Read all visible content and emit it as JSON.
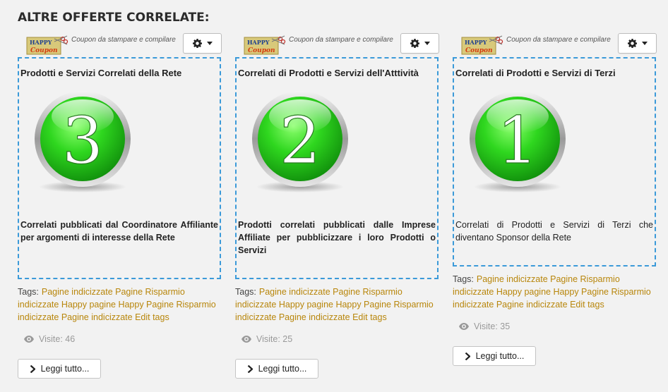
{
  "section": {
    "title": "ALTRE OFFERTE CORRELATE:"
  },
  "colors": {
    "accent_border": "#3b9ad9",
    "tag_link": "#b8860b",
    "badge_green": "#22c51a"
  },
  "cards": [
    {
      "coupon_logo_line1": "HAPPY",
      "coupon_logo_line2": "Coupon",
      "coupon_caption": "Coupon da stampare e compilare",
      "title": "Prodotti e Servizi Correlati della Rete",
      "number": "3",
      "description": "Correlati pubblicati dal Coordinatore Affiliante per argomenti di interesse della Rete",
      "tags_label": "Tags:",
      "tags": "Pagine indicizzate Pagine Risparmio indicizzate Happy pagine Happy Pagine Risparmio indicizzate Pagine indicizzate Edit tags",
      "views": "Visite: 46",
      "read_more": "Leggi tutto..."
    },
    {
      "coupon_logo_line1": "HAPPY",
      "coupon_logo_line2": "Coupon",
      "coupon_caption": "Coupon da stampare e compilare",
      "title": "Correlati di Prodotti e Servizi dell'Atttività",
      "number": "2",
      "description": "Prodotti correlati pubblicati dalle Imprese Affiliate per pubblicizzare i loro Prodotti o Servizi",
      "tags_label": "Tags:",
      "tags": "Pagine indicizzate Pagine Risparmio indicizzate Happy pagine Happy Pagine Risparmio indicizzate Pagine indicizzate Edit tags",
      "views": "Visite: 25",
      "read_more": "Leggi tutto..."
    },
    {
      "coupon_logo_line1": "HAPPY",
      "coupon_logo_line2": "Coupon",
      "coupon_caption": "Coupon da stampare e compilare",
      "title": "Correlati di Prodotti e Servizi di Terzi",
      "number": "1",
      "description": "Correlati di Prodotti e Servizi di Terzi che diventano Sponsor della Rete",
      "tags_label": "Tags:",
      "tags": "Pagine indicizzate Pagine Risparmio indicizzate Happy pagine Happy Pagine Risparmio indicizzate Pagine indicizzate Edit tags",
      "views": "Visite: 35",
      "read_more": "Leggi tutto..."
    }
  ]
}
